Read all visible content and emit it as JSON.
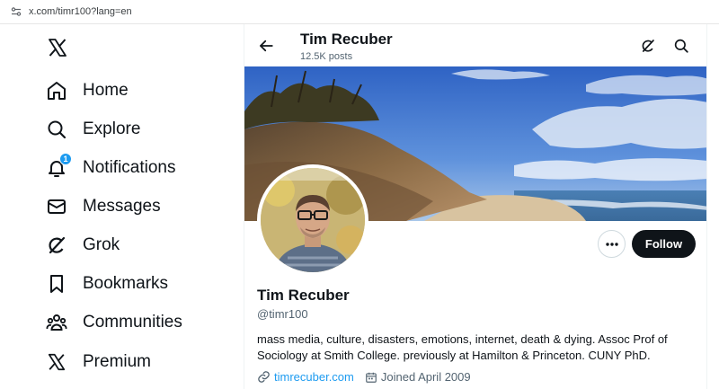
{
  "browser": {
    "url": "x.com/timr100?lang=en"
  },
  "nav": {
    "items": [
      {
        "label": "Home",
        "icon": "home-icon"
      },
      {
        "label": "Explore",
        "icon": "search-icon"
      },
      {
        "label": "Notifications",
        "icon": "bell-icon",
        "badge": "1"
      },
      {
        "label": "Messages",
        "icon": "envelope-icon"
      },
      {
        "label": "Grok",
        "icon": "grok-icon"
      },
      {
        "label": "Bookmarks",
        "icon": "bookmark-icon"
      },
      {
        "label": "Communities",
        "icon": "people-icon"
      },
      {
        "label": "Premium",
        "icon": "x-logo-icon"
      }
    ]
  },
  "header": {
    "name": "Tim Recuber",
    "post_count": "12.5K posts"
  },
  "profile": {
    "name": "Tim Recuber",
    "handle": "@timr100",
    "bio": "mass media, culture, disasters, emotions, internet, death & dying. Assoc Prof of Sociology at Smith College. previously at Hamilton & Princeton. CUNY PhD.",
    "website": "timrecuber.com",
    "joined": "Joined April 2009",
    "follow_label": "Follow"
  },
  "colors": {
    "accent": "#1d9bf0",
    "text": "#0f1419",
    "muted": "#536471",
    "button_dark": "#0f1419"
  }
}
